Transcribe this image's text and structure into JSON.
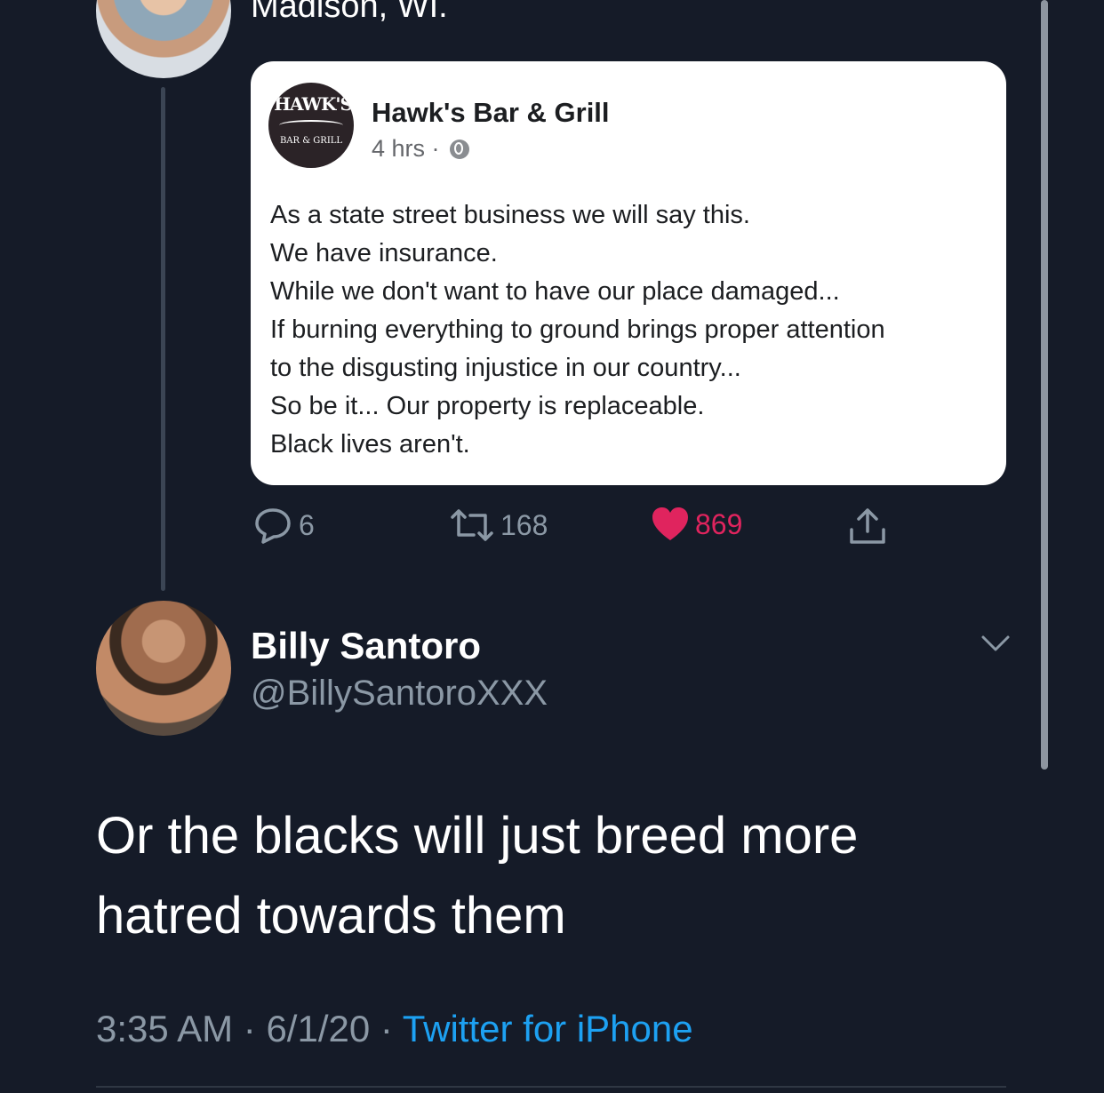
{
  "quoted_header": {
    "location_text": "Madison, WI."
  },
  "facebook_post": {
    "logo_text_top": "HAWK'S",
    "logo_text_bottom": "BAR & GRILL",
    "page_name": "Hawk's Bar & Grill",
    "time": "4 hrs · ",
    "privacy_icon": "globe-icon",
    "lines": [
      "As a state street business we will say this.",
      "We have insurance.",
      "While we don't want to have our place damaged...",
      "If burning everything to ground brings proper attention",
      "to the disgusting injustice in our country...",
      "So be it... Our property is replaceable.",
      "Black lives aren't."
    ]
  },
  "actions": {
    "reply_count": "6",
    "retweet_count": "168",
    "like_count": "869",
    "colors": {
      "like": "#e0245e",
      "muted": "#8b98a5"
    }
  },
  "tweet": {
    "display_name": "Billy Santoro",
    "handle": "@BillySantoroXXX",
    "text_lines": [
      "Or the blacks will just breed more",
      "hatred towards them"
    ],
    "time": "3:35 AM",
    "date": "6/1/20",
    "separator": " · ",
    "source": "Twitter for iPhone",
    "colors": {
      "link": "#1da1f2",
      "background": "#151b28"
    }
  }
}
